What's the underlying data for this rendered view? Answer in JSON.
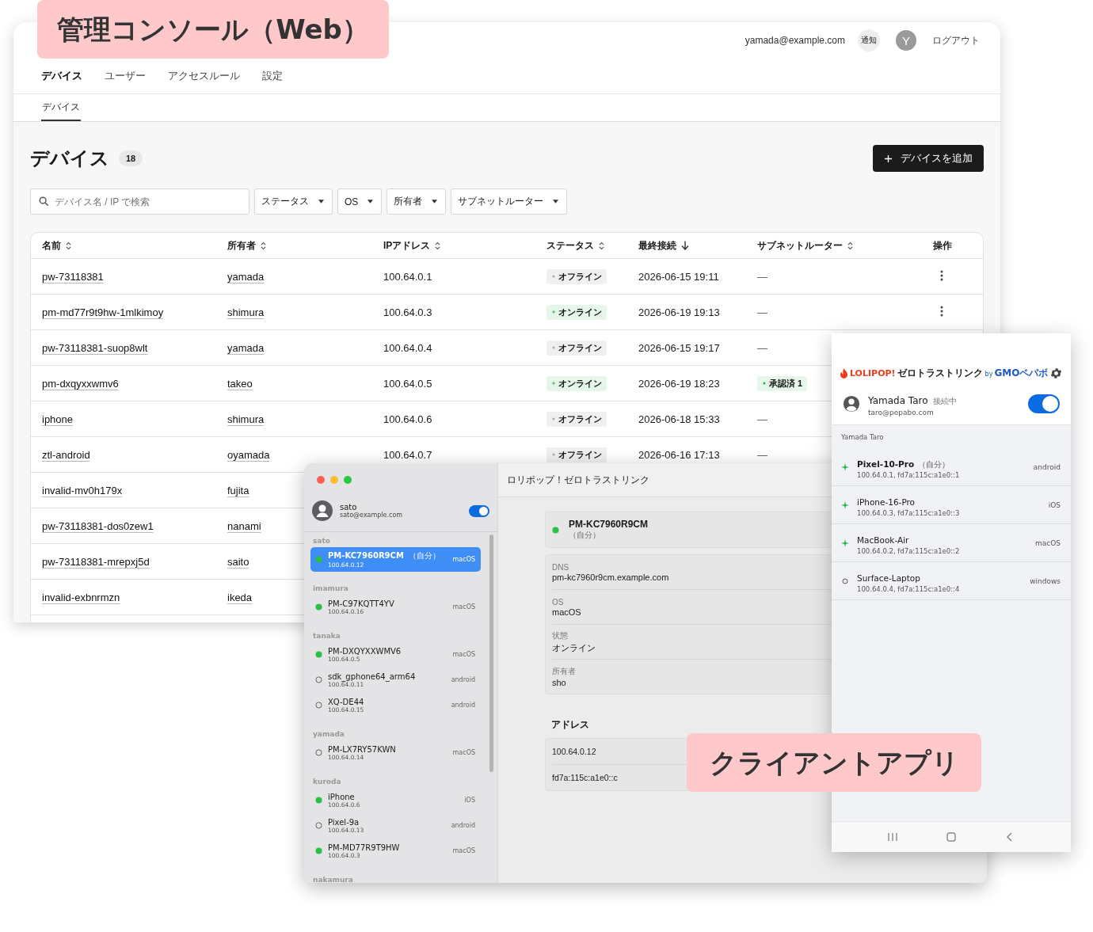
{
  "web": {
    "caption": "管理コンソール（Web）",
    "account": {
      "email": "yamada@example.com",
      "notify": "通知",
      "avatar": "Y",
      "logout": "ログアウト"
    },
    "nav": [
      {
        "label": "デバイス",
        "selected": true
      },
      {
        "label": "ユーザー",
        "selected": false
      },
      {
        "label": "アクセスルール",
        "selected": false
      },
      {
        "label": "設定",
        "selected": false
      }
    ],
    "subtabs": [
      {
        "label": "デバイス",
        "selected": true
      }
    ],
    "title": "デバイス",
    "count": "18",
    "add_button": "デバイスを追加",
    "search": {
      "placeholder": "デバイス名 / IP で検索"
    },
    "filters": [
      "ステータス",
      "OS",
      "所有者",
      "サブネットルーター"
    ],
    "table": {
      "columns": [
        {
          "label": "名前",
          "sortable": true,
          "sorted_desc": false
        },
        {
          "label": "所有者",
          "sortable": true,
          "sorted_desc": false
        },
        {
          "label": "IPアドレス",
          "sortable": true,
          "sorted_desc": false
        },
        {
          "label": "ステータス",
          "sortable": true,
          "sorted_desc": false
        },
        {
          "label": "最終接続",
          "sortable": true,
          "sorted_desc": true
        },
        {
          "label": "サブネットルーター",
          "sortable": true,
          "sorted_desc": false
        },
        {
          "label": "操作",
          "sortable": false
        }
      ],
      "rows": [
        {
          "name": "pw-73118381",
          "owner": "yamada",
          "ip": "100.64.0.1",
          "status": {
            "text": "オフライン",
            "online": false
          },
          "last": "2026-06-15 19:11",
          "router": {
            "text": "—",
            "kind": "none"
          },
          "actions": true
        },
        {
          "name": "pm-md77r9t9hw-1mlkimoy",
          "owner": "shimura",
          "ip": "100.64.0.3",
          "status": {
            "text": "オンライン",
            "online": true
          },
          "last": "2026-06-19 19:13",
          "router": {
            "text": "—",
            "kind": "none"
          },
          "actions": true
        },
        {
          "name": "pw-73118381-suop8wlt",
          "owner": "yamada",
          "ip": "100.64.0.4",
          "status": {
            "text": "オフライン",
            "online": false
          },
          "last": "2026-06-15 19:17",
          "router": {
            "text": "—",
            "kind": "none"
          }
        },
        {
          "name": "pm-dxqyxxwmv6",
          "owner": "takeo",
          "ip": "100.64.0.5",
          "status": {
            "text": "オンライン",
            "online": true
          },
          "last": "2026-06-19 18:23",
          "router": {
            "text": "承認済 1",
            "kind": "approved"
          }
        },
        {
          "name": "iphone",
          "owner": "shimura",
          "ip": "100.64.0.6",
          "status": {
            "text": "オフライン",
            "online": false
          },
          "last": "2026-06-18 15:33",
          "router": {
            "text": "—",
            "kind": "none"
          }
        },
        {
          "name": "ztl-android",
          "owner": "oyamada",
          "ip": "100.64.0.7",
          "status": {
            "text": "オフライン",
            "online": false
          },
          "last": "2026-06-16 17:13",
          "router": {
            "text": "—",
            "kind": "none"
          }
        },
        {
          "name": "invalid-mv0h179x",
          "owner": "fujita"
        },
        {
          "name": "pw-73118381-dos0zew1",
          "owner": "nanami"
        },
        {
          "name": "pw-73118381-mrepxj5d",
          "owner": "saito"
        },
        {
          "name": "invalid-exbnrmzn",
          "owner": "ikeda"
        }
      ]
    }
  },
  "mac": {
    "title": "ロリポップ！ゼロトラストリンク",
    "user": {
      "name": "sato",
      "email": "sato@example.com",
      "connected": true
    },
    "groups": [
      {
        "owner": "sato",
        "devices": [
          {
            "name": "PM-KC7960R9CM",
            "tag": "（自分）",
            "ip": "100.64.0.12",
            "os": "macOS",
            "online": true,
            "selected": true
          }
        ]
      },
      {
        "owner": "imamura",
        "devices": [
          {
            "name": "PM-C97KQTT4YV",
            "ip": "100.64.0.16",
            "os": "macOS",
            "online": true,
            "selected": false
          }
        ]
      },
      {
        "owner": "tanaka",
        "devices": [
          {
            "name": "PM-DXQYXXWMV6",
            "ip": "100.64.0.5",
            "os": "macOS",
            "online": true,
            "selected": false
          },
          {
            "name": "sdk_gphone64_arm64",
            "ip": "100.64.0.11",
            "os": "android",
            "online": false,
            "selected": false
          },
          {
            "name": "XQ-DE44",
            "ip": "100.64.0.15",
            "os": "android",
            "online": false,
            "selected": false
          }
        ]
      },
      {
        "owner": "yamada",
        "devices": [
          {
            "name": "PM-LX7RY57KWN",
            "ip": "100.64.0.14",
            "os": "macOS",
            "online": false,
            "selected": false
          }
        ]
      },
      {
        "owner": "kuroda",
        "devices": [
          {
            "name": "iPhone",
            "ip": "100.64.0.6",
            "os": "iOS",
            "online": true,
            "selected": false
          },
          {
            "name": "Pixel-9a",
            "ip": "100.64.0.13",
            "os": "android",
            "online": false,
            "selected": false
          },
          {
            "name": "PM-MD77R9T9HW",
            "ip": "100.64.0.3",
            "os": "macOS",
            "online": true,
            "selected": false
          }
        ]
      },
      {
        "owner": "nakamura"
      }
    ],
    "detail": {
      "name": "PM-KC7960R9CM",
      "tag": "（自分）",
      "online": true,
      "fields": [
        {
          "label": "DNS",
          "value": "pm-kc7960r9cm.example.com"
        },
        {
          "label": "OS",
          "value": "macOS"
        },
        {
          "label": "状態",
          "value": "オンライン"
        },
        {
          "label": "所有者",
          "value": "sho"
        }
      ],
      "address_heading": "アドレス",
      "addresses": [
        "100.64.0.12",
        "fd7a:115c:a1e0::c"
      ]
    }
  },
  "android": {
    "caption": "クライアントアプリ",
    "logo": {
      "brand": "LOLIPOP!",
      "product": "ゼロトラストリンク",
      "by": "by",
      "company": "GMOペパボ"
    },
    "user": {
      "name": "Yamada Taro",
      "state": "接続中",
      "email": "taro@pepabo.com",
      "connected": true
    },
    "group_label": "Yamada Taro",
    "devices": [
      {
        "name": "Pixel-10-Pro",
        "tag": "（自分）",
        "addresses": "100.64.0.1, fd7a:115c:a1e0::1",
        "os": "android",
        "online": true
      },
      {
        "name": "iPhone-16-Pro",
        "addresses": "100.64.0.3, fd7a:115c:a1e0::3",
        "os": "iOS",
        "online": true
      },
      {
        "name": "MacBook-Air",
        "addresses": "100.64.0.2, fd7a:115c:a1e0::2",
        "os": "macOS",
        "online": true
      },
      {
        "name": "Surface-Laptop",
        "addresses": "100.64.0.4, fd7a:115c:a1e0::4",
        "os": "windows",
        "online": false
      }
    ]
  }
}
